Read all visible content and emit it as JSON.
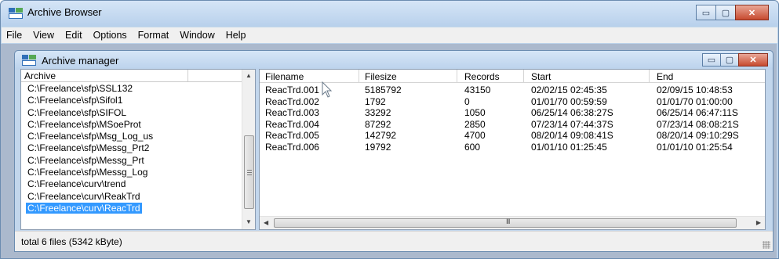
{
  "window": {
    "title": "Archive Browser",
    "controls": {
      "minimize": "▭",
      "maximize": "▢",
      "close": "✕"
    }
  },
  "menubar": {
    "items": [
      "File",
      "View",
      "Edit",
      "Options",
      "Format",
      "Window",
      "Help"
    ]
  },
  "inner_window": {
    "title": "Archive manager",
    "controls": {
      "minimize": "▭",
      "maximize": "▢",
      "close": "✕"
    }
  },
  "archive_list": {
    "header": "Archive",
    "items": [
      "C:\\Freelance\\sfp\\SSL132",
      "C:\\Freelance\\sfp\\Sifol1",
      "C:\\Freelance\\sfp\\SIFOL",
      "C:\\Freelance\\sfp\\MSoeProt",
      "C:\\Freelance\\sfp\\Msg_Log_us",
      "C:\\Freelance\\sfp\\Messg_Prt2",
      "C:\\Freelance\\sfp\\Messg_Prt",
      "C:\\Freelance\\sfp\\Messg_Log",
      "C:\\Freelance\\curv\\trend",
      "C:\\Freelance\\curv\\ReakTrd",
      "C:\\Freelance\\curv\\ReacTrd"
    ],
    "selected_index": 10
  },
  "file_table": {
    "columns": [
      "Filename",
      "Filesize",
      "Records",
      "Start",
      "End"
    ],
    "rows": [
      [
        "ReacTrd.001",
        "5185792",
        "43150",
        "02/02/15 02:45:35",
        "02/09/15 10:48:53"
      ],
      [
        "ReacTrd.002",
        "1792",
        "0",
        "01/01/70 00:59:59",
        "01/01/70 01:00:00"
      ],
      [
        "ReacTrd.003",
        "33292",
        "1050",
        "06/25/14 06:38:27S",
        "06/25/14 06:47:11S"
      ],
      [
        "ReacTrd.004",
        "87292",
        "2850",
        "07/23/14 07:44:37S",
        "07/23/14 08:08:21S"
      ],
      [
        "ReacTrd.005",
        "142792",
        "4700",
        "08/20/14 09:08:41S",
        "08/20/14 09:10:29S"
      ],
      [
        "ReacTrd.006",
        "19792",
        "600",
        "01/01/10 01:25:45",
        "01/01/10 01:25:54"
      ]
    ]
  },
  "status": {
    "text": "total 6 files (5342 kByte)"
  },
  "colors": {
    "selection": "#3399ff",
    "title_bar": "#bcd3ea",
    "close_button": "#c74a2f"
  }
}
